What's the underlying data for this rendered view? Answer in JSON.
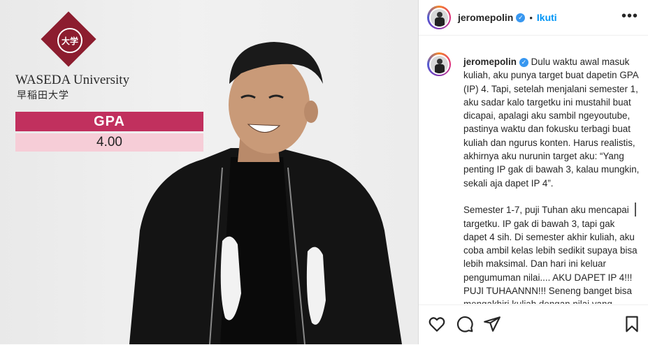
{
  "image": {
    "logo_crest_text": "大学",
    "university_name": "WASEDA University",
    "university_japanese": "早稲田大学",
    "gpa_label": "GPA",
    "gpa_value": "4.00",
    "colors": {
      "logo": "#8c1d2f",
      "gpa_header": "#c1305e",
      "gpa_value_bg": "#f6cdd7"
    }
  },
  "header": {
    "username": "jeromepolin",
    "separator": "•",
    "follow_label": "Ikuti",
    "more_icon": "more-options-icon"
  },
  "caption": {
    "username": "jeromepolin",
    "text": "Dulu waktu awal masuk kuliah, aku punya target buat dapetin GPA (IP) 4. Tapi, setelah menjalani semester 1, aku sadar kalo targetku ini mustahil buat dicapai, apalagi aku sambil ngeyoutube, pastinya waktu dan fokusku terbagi buat kuliah dan ngurus konten. Harus realistis, akhirnya aku nurunin target aku: “Yang penting IP gak di bawah 3, kalau mungkin, sekali aja dapet IP 4”.\n\nSemester 1-7, puji Tuhan aku mencapai targetku. IP gak di bawah 3, tapi gak dapet 4 sih. Di semester akhir kuliah, aku coba ambil kelas lebih sedikit supaya bisa lebih maksimal. Dan hari ini keluar pengumuman nilai.... AKU DAPET IP 4!!! PUJI TUHAANNN!!! Seneng banget bisa mengakhiri kuliah dengan nilai yang"
  },
  "actions": {
    "like_icon": "heart-icon",
    "comment_icon": "comment-icon",
    "share_icon": "share-icon",
    "save_icon": "bookmark-icon"
  },
  "colors": {
    "follow": "#0095f6",
    "verified": "#3897f0"
  }
}
